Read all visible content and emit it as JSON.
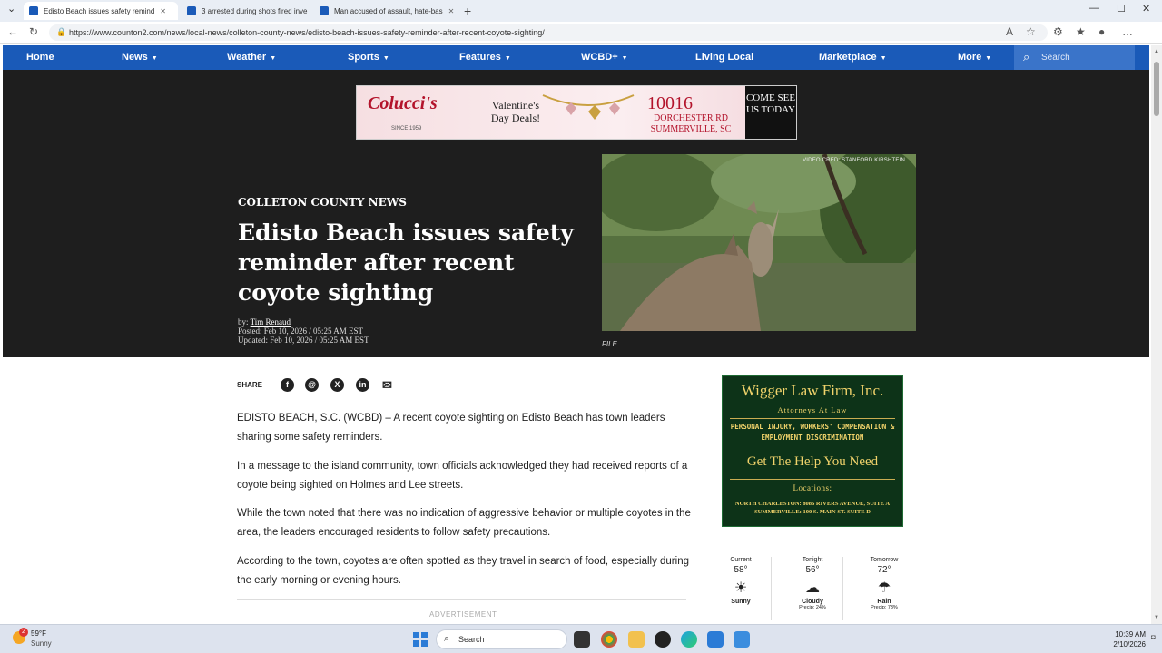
{
  "browser": {
    "tabs": [
      {
        "title": "Edisto Beach issues safety remind"
      },
      {
        "title": "3 arrested during shots fired inve"
      },
      {
        "title": "Man accused of assault, hate-bas"
      }
    ],
    "url": "https://www.counton2.com/news/local-news/colleton-county-news/edisto-beach-issues-safety-reminder-after-recent-coyote-sighting/"
  },
  "nav": {
    "items": [
      {
        "label": "Home",
        "caret": false
      },
      {
        "label": "News",
        "caret": true
      },
      {
        "label": "Weather",
        "caret": true
      },
      {
        "label": "Sports",
        "caret": true
      },
      {
        "label": "Features",
        "caret": true
      },
      {
        "label": "WCBD+",
        "caret": true
      },
      {
        "label": "Living Local",
        "caret": false
      },
      {
        "label": "Marketplace",
        "caret": true
      },
      {
        "label": "More",
        "caret": true
      }
    ],
    "search_label": "Search"
  },
  "banner_ad": {
    "brand": "Colucci's",
    "since": "SINCE 1959",
    "deal": "Valentine's Day Deals!",
    "number": "10016",
    "street": "DORCHESTER RD SUMMERVILLE, SC",
    "cta": "COME SEE US TODAY"
  },
  "article": {
    "section": "COLLETON COUNTY NEWS",
    "headline": "Edisto Beach issues safety reminder after recent coyote sighting",
    "by_prefix": "by:",
    "author": "Tim Renaud",
    "posted": "Posted: Feb 10, 2026 / 05:25 AM EST",
    "updated": "Updated: Feb 10, 2026 / 05:25 AM EST",
    "photo_credit": "VIDEO CRED: STANFORD KIRSHTEIN",
    "photo_caption": "FILE",
    "share_label": "SHARE",
    "paragraphs": [
      "EDISTO BEACH, S.C. (WCBD) – A recent coyote sighting on Edisto Beach has town leaders sharing some safety reminders.",
      "In a message to the island community, town officials acknowledged they had received reports of a coyote being sighted on Holmes and Lee streets.",
      "While the town noted that there was no indication of aggressive behavior or multiple coyotes in the area, the leaders encouraged residents to follow safety precautions.",
      "According to the town, coyotes are often spotted as they travel in search of food, especially during the early morning or evening hours."
    ],
    "advertisement_label": "ADVERTISEMENT"
  },
  "law_ad": {
    "name": "Wigger Law Firm, Inc.",
    "subtitle": "Attorneys At Law",
    "services": "PERSONAL INJURY, WORKERS' COMPENSATION & EMPLOYMENT DISCRIMINATION",
    "tagline": "Get The Help You Need",
    "locations_label": "Locations:",
    "locations": "NORTH CHARLESTON: 8086 RIVERS AVENUE, SUITE A SUMMERVILLE: 100 S. MAIN ST. SUITE D"
  },
  "weather": [
    {
      "label": "Current",
      "temp": "58°",
      "icon": "sun-icon",
      "glyph": "☀",
      "cond": "Sunny",
      "precip": ""
    },
    {
      "label": "Tonight",
      "temp": "56°",
      "icon": "cloud-icon",
      "glyph": "☁",
      "cond": "Cloudy",
      "precip": "Precip: 24%"
    },
    {
      "label": "Tomorrow",
      "temp": "72°",
      "icon": "rain-icon",
      "glyph": "☂",
      "cond": "Rain",
      "precip": "Precip: 73%"
    }
  ],
  "taskbar": {
    "temp": "59°F",
    "cond": "Sunny",
    "badge": "2",
    "search_label": "Search",
    "time": "10:39 AM",
    "date": "2/10/2026"
  }
}
